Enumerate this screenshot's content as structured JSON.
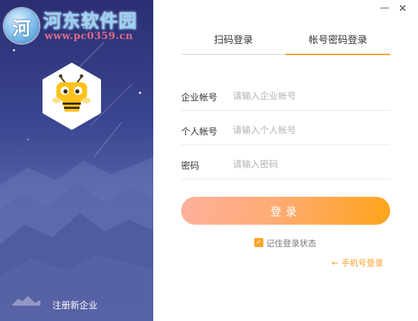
{
  "window": {
    "minimize_icon": "minimize-icon",
    "close_icon": "close-icon",
    "minimize_glyph": "—",
    "close_glyph": "✕"
  },
  "watermark": {
    "logo_text": "河",
    "title": "河东软件园",
    "url": "www.pc0359.cn"
  },
  "left_panel": {
    "register_label": "注册新企业",
    "app_logo_icon": "bee-mascot-icon"
  },
  "tabs": {
    "qr_login": "扫码登录",
    "password_login": "帐号密码登录",
    "active": "password_login"
  },
  "form": {
    "company": {
      "label": "企业帐号",
      "placeholder": "请输入企业帐号",
      "value": ""
    },
    "user": {
      "label": "个人帐号",
      "placeholder": "请输入个人帐号",
      "value": ""
    },
    "password": {
      "label": "密码",
      "placeholder": "请输入密码",
      "value": ""
    },
    "login_button": "登录"
  },
  "remember": {
    "label": "记住登录状态",
    "checked": true,
    "check_glyph": "✓"
  },
  "phone_login": {
    "label": "手机号登录",
    "arrow_glyph": "←"
  },
  "colors": {
    "accent": "#ff9f2a",
    "panel_top": "#2a2f72",
    "panel_bottom": "#6574b1"
  }
}
